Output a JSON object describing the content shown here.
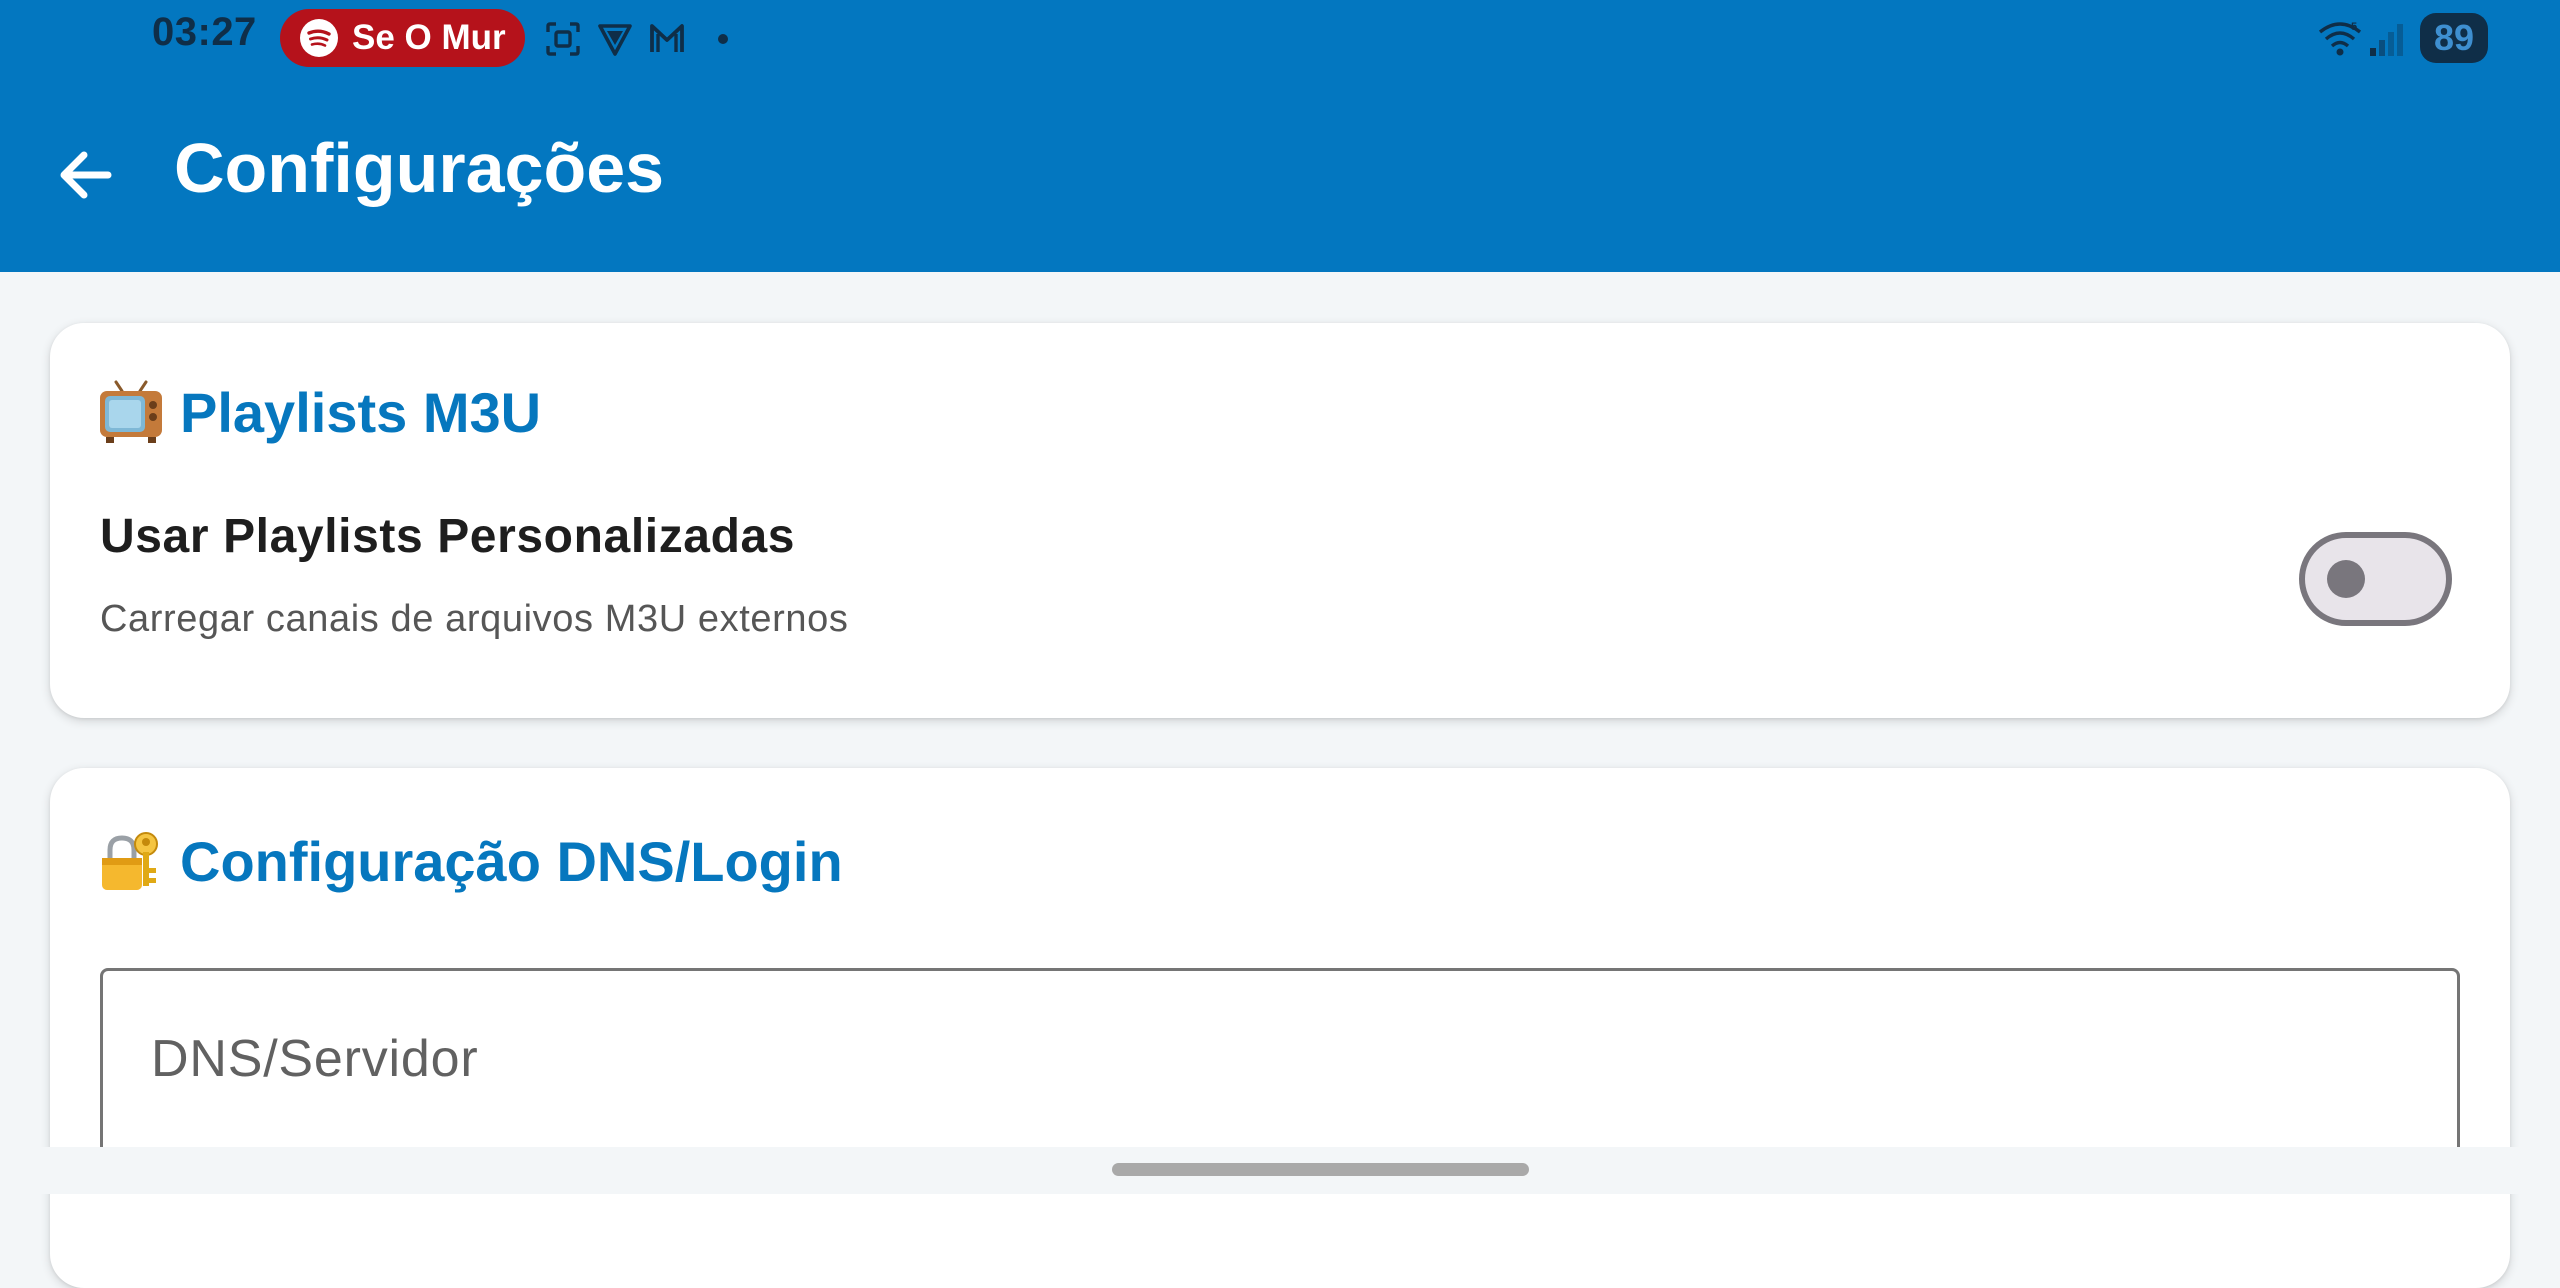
{
  "status_bar": {
    "time": "03:27",
    "media_pill_text": "Se O Mur",
    "battery": "89",
    "icons": [
      "spotify-icon",
      "screenshot-icon",
      "vpn-shield-icon",
      "gmail-icon",
      "notification-dot-icon",
      "wifi-icon",
      "signal-icon",
      "battery-icon"
    ]
  },
  "app_bar": {
    "title": "Configurações",
    "back_icon": "arrow-left-icon"
  },
  "sections": [
    {
      "emoji": "television-icon",
      "heading": "Playlists M3U",
      "setting": {
        "title": "Usar Playlists Personalizadas",
        "subtitle": "Carregar canais de arquivos M3U externos",
        "enabled": false
      }
    },
    {
      "emoji": "locked-with-key-icon",
      "heading": "Configuração DNS/Login",
      "field": {
        "placeholder": "DNS/Servidor"
      }
    }
  ],
  "colors": {
    "app_bar": "#0377C0",
    "section_heading": "#0677BE",
    "page_background": "#F3F6F8",
    "media_pill": "#B5121B"
  }
}
